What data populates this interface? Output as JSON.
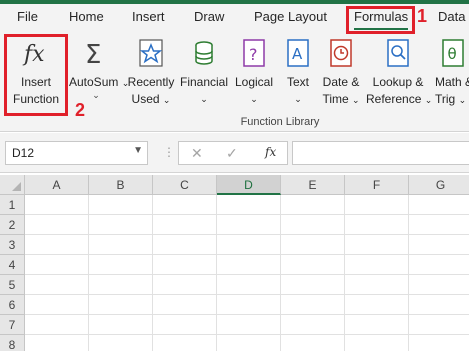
{
  "tabs": [
    "File",
    "Home",
    "Insert",
    "Draw",
    "Page Layout",
    "Formulas",
    "Data"
  ],
  "active_tab": "Formulas",
  "ribbon": {
    "insert_function": [
      "Insert",
      "Function"
    ],
    "autosum": "AutoSum",
    "recently_used": [
      "Recently",
      "Used"
    ],
    "financial": "Financial",
    "logical": "Logical",
    "text": "Text",
    "date_time": [
      "Date &",
      "Time"
    ],
    "lookup_reference": [
      "Lookup &",
      "Reference"
    ],
    "math_trig": [
      "Math &",
      "Trig"
    ],
    "group_label": "Function Library"
  },
  "annotations": {
    "step1": "1",
    "step2": "2"
  },
  "formula_bar": {
    "name_box": "D12",
    "formula": "",
    "fx": "fx"
  },
  "columns": [
    "A",
    "B",
    "C",
    "D",
    "E",
    "F",
    "G"
  ],
  "selected_column": "D",
  "rows": [
    "1",
    "2",
    "3",
    "4",
    "5",
    "6",
    "7",
    "8"
  ],
  "colors": {
    "accent": "#217346",
    "annotation": "#e0202a"
  }
}
